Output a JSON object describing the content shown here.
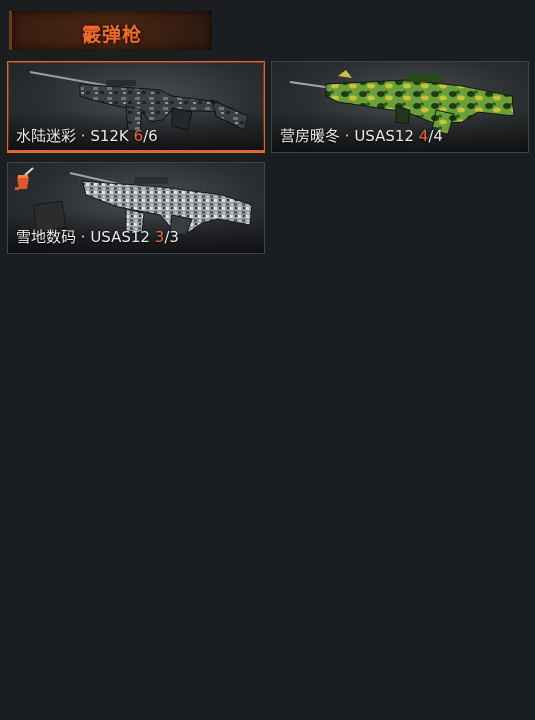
{
  "category": {
    "title": "霰弹枪"
  },
  "accent_color": "#ef6a35",
  "cards": [
    {
      "skin": "水陆迷彩",
      "separator": " · ",
      "weapon": "S12K",
      "owned": "6",
      "slash": "/",
      "total": "6",
      "selected": true,
      "pattern": "dark-camo"
    },
    {
      "skin": "营房暖冬",
      "separator": " · ",
      "weapon": "USAS12",
      "owned": "4",
      "slash": "/",
      "total": "4",
      "selected": false,
      "pattern": "green-camo"
    },
    {
      "skin": "雪地数码",
      "separator": " · ",
      "weapon": "USAS12",
      "owned": "3",
      "slash": "/",
      "total": "3",
      "selected": false,
      "pattern": "snow-digital",
      "badge_icon": "paint-brush-icon"
    }
  ]
}
